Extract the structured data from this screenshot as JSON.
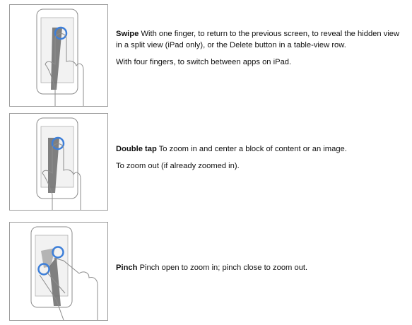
{
  "gestures": [
    {
      "icon": "swipe-gesture-icon",
      "title": "Swipe",
      "description": "With one finger, to return to the previous screen, to reveal the hidden view in a split view (iPad only), or the Delete button in a table-view row.",
      "extra": "With four fingers, to switch between apps on iPad."
    },
    {
      "icon": "double-tap-gesture-icon",
      "title": "Double tap",
      "description": "To zoom in and center a block of content or an image.",
      "extra": "To zoom out (if already zoomed in)."
    },
    {
      "icon": "pinch-gesture-icon",
      "title": "Pinch",
      "description": "Pinch open to zoom in; pinch close to zoom out."
    }
  ],
  "colors": {
    "touch_ring": "#3d7fd9",
    "motion_trail": "#6b6b6b",
    "outline": "#8c8c8c"
  }
}
